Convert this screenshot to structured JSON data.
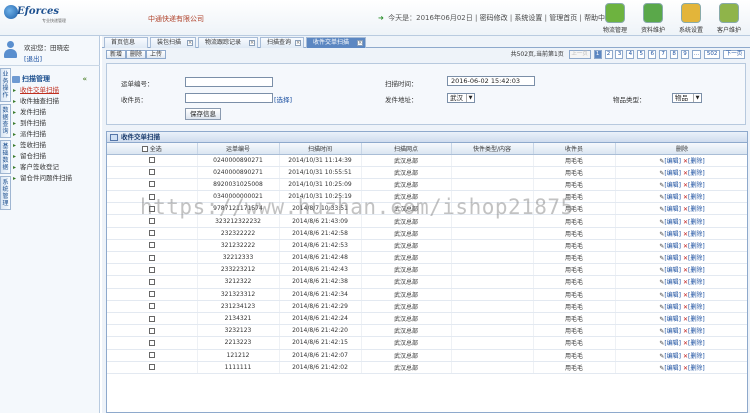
{
  "header": {
    "logo_text": "Eforces",
    "logo_sub": "专业快递管理",
    "company": "中通快递有限公司",
    "info_text": "今天是：2016年06月02日",
    "links": [
      "密码修改",
      "系统设置",
      "管理首页",
      "帮助中心"
    ]
  },
  "topnav": [
    {
      "label": "物流管理",
      "color": "#6db33f"
    },
    {
      "label": "资料维护",
      "color": "#5aa84a"
    },
    {
      "label": "系统设置",
      "color": "#e3b53a"
    },
    {
      "label": "客户维护",
      "color": "#8fb44a"
    }
  ],
  "user": {
    "name": "欢迎您：田晓宏",
    "logout": "[退出]"
  },
  "vtabs": [
    "业务操作",
    "数据查询",
    "基础数据",
    "系统管理"
  ],
  "menu": {
    "head": "扫描管理",
    "items": [
      "收件交单扫描",
      "收件抽查扫描",
      "发件扫描",
      "到件扫描",
      "派件扫描",
      "签收扫描",
      "留仓扫描",
      "客户签收登记",
      "留仓件问题件扫描"
    ]
  },
  "tabs": [
    {
      "label": "首页信息"
    },
    {
      "label": "装包扫描"
    },
    {
      "label": "物流跟踪记录"
    },
    {
      "label": "扫描查询"
    },
    {
      "label": "收件交单扫描"
    }
  ],
  "toolbar": {
    "add": "新增",
    "delete": "删除",
    "import": "上传",
    "page_info": "共502页,当前第1页",
    "prev": "上一页",
    "pages": [
      "1",
      "2",
      "3",
      "4",
      "5",
      "6",
      "7",
      "8",
      "9",
      "..."
    ],
    "last": "502",
    "next": "下一页"
  },
  "form": {
    "waybill_label": "运单编号：",
    "waybill_value": "",
    "scan_time_label": "扫描时间：",
    "scan_time_value": "2016-06-02 15:42:03",
    "courier_label": "收件员：",
    "courier_value": "",
    "select_link": "[选择]",
    "dest_label": "发件地址：",
    "dest_value": "武汉",
    "type_label": "物品类型：",
    "type_value": "物品",
    "save": "保存信息"
  },
  "grid": {
    "title": "收件交单扫描",
    "columns": [
      "全选",
      "运单编号",
      "扫描时间",
      "扫描网点",
      "快件类型/内容",
      "收件员",
      "删除"
    ],
    "rows": [
      {
        "id": "0240000890271",
        "time": "2014/10/31 11:14:39",
        "site": "武汉总部",
        "type": "",
        "person": "用毛毛"
      },
      {
        "id": "0240000890271",
        "time": "2014/10/31 10:55:51",
        "site": "武汉总部",
        "type": "",
        "person": "用毛毛"
      },
      {
        "id": "8920031025008",
        "time": "2014/10/31 10:25:09",
        "site": "武汉总部",
        "type": "",
        "person": "用毛毛"
      },
      {
        "id": "0340000000021",
        "time": "2014/10/31 10:25:19",
        "site": "武汉总部",
        "type": "",
        "person": "用毛毛"
      },
      {
        "id": "9787121171574",
        "time": "2014/8/7 10:33:51",
        "site": "武汉总部",
        "type": "",
        "person": "用毛毛"
      },
      {
        "id": "323212322232",
        "time": "2014/8/6 21:43:09",
        "site": "武汉总部",
        "type": "",
        "person": "用毛毛"
      },
      {
        "id": "232322222",
        "time": "2014/8/6 21:42:58",
        "site": "武汉总部",
        "type": "",
        "person": "用毛毛"
      },
      {
        "id": "321232222",
        "time": "2014/8/6 21:42:53",
        "site": "武汉总部",
        "type": "",
        "person": "用毛毛"
      },
      {
        "id": "32212333",
        "time": "2014/8/6 21:42:48",
        "site": "武汉总部",
        "type": "",
        "person": "用毛毛"
      },
      {
        "id": "233223212",
        "time": "2014/8/6 21:42:43",
        "site": "武汉总部",
        "type": "",
        "person": "用毛毛"
      },
      {
        "id": "3212322",
        "time": "2014/8/6 21:42:38",
        "site": "武汉总部",
        "type": "",
        "person": "用毛毛"
      },
      {
        "id": "321323312",
        "time": "2014/8/6 21:42:34",
        "site": "武汉总部",
        "type": "",
        "person": "用毛毛"
      },
      {
        "id": "231234123",
        "time": "2014/8/6 21:42:29",
        "site": "武汉总部",
        "type": "",
        "person": "用毛毛"
      },
      {
        "id": "2134321",
        "time": "2014/8/6 21:42:24",
        "site": "武汉总部",
        "type": "",
        "person": "用毛毛"
      },
      {
        "id": "3232123",
        "time": "2014/8/6 21:42:20",
        "site": "武汉总部",
        "type": "",
        "person": "用毛毛"
      },
      {
        "id": "2213223",
        "time": "2014/8/6 21:42:15",
        "site": "武汉总部",
        "type": "",
        "person": "用毛毛"
      },
      {
        "id": "121212",
        "time": "2014/8/6 21:42:07",
        "site": "武汉总部",
        "type": "",
        "person": "用毛毛"
      },
      {
        "id": "1111111",
        "time": "2014/8/6 21:42:02",
        "site": "武汉总部",
        "type": "",
        "person": "用毛毛"
      }
    ],
    "edit_label": "[编辑]",
    "delete_label": "[删除]"
  },
  "watermark": "https://www.huzhan.com/ishop21875"
}
